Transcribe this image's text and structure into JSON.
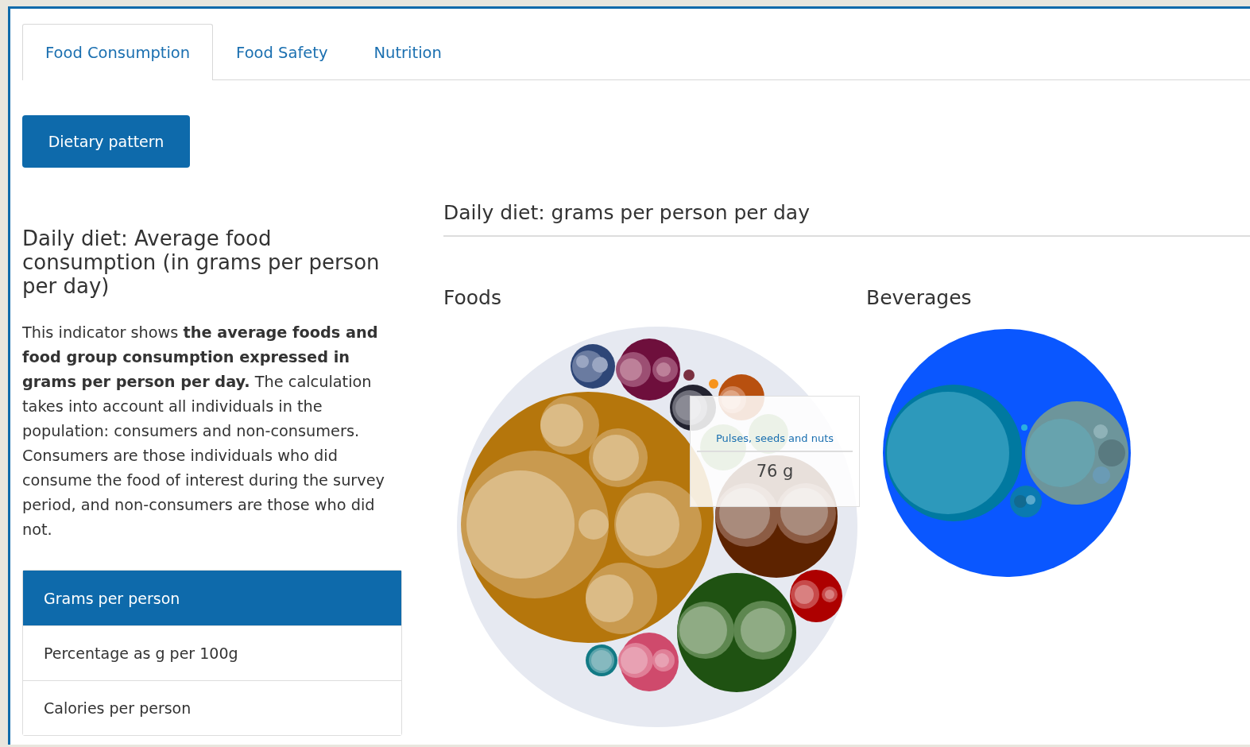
{
  "tabs": [
    {
      "label": "Food Consumption",
      "selected": true
    },
    {
      "label": "Food Safety",
      "selected": false
    },
    {
      "label": "Nutrition",
      "selected": false
    }
  ],
  "action_button": "Dietary pattern",
  "indicator": {
    "title": "Daily diet: Average food consumption (in grams per person per day)",
    "description": "This indicator shows **the average foods and food group consumption expressed in grams per person per day.** The calculation takes into account all individuals in the population: consumers and non-consumers. Consumers are those individuals who did consume the food of interest during the survey period, and non-consumers are those who did not."
  },
  "measures": [
    {
      "label": "Grams per person",
      "selected": true
    },
    {
      "label": "Percentage as g per 100g",
      "selected": false
    },
    {
      "label": "Calories per person",
      "selected": false
    }
  ],
  "chart_panel": {
    "title": "Daily diet: grams per person per day",
    "charts": [
      {
        "kind": "foods",
        "title": "Foods",
        "tooltip": {
          "label": "Pulses, seeds and nuts",
          "value": "76 g"
        }
      },
      {
        "kind": "beverages",
        "title": "Beverages"
      }
    ]
  }
}
